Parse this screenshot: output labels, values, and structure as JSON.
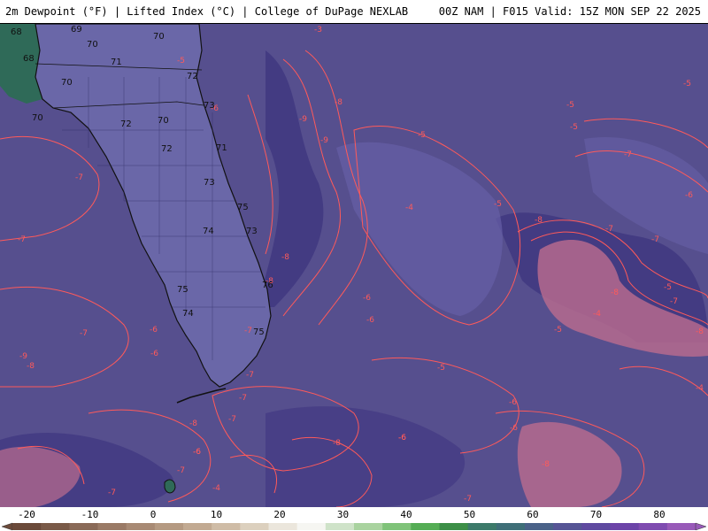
{
  "header": {
    "left_title": "2m Dewpoint (°F) | Lifted Index (°C) | College of DuPage NEXLAB",
    "right_title": "00Z NAM | F015 Valid: 15Z MON SEP 22 2025"
  },
  "map": {
    "background_color": "#564f8e",
    "contour_color": "#ff5a5a",
    "dewpoint_labels": [
      "69",
      "70",
      "70",
      "71",
      "70",
      "68",
      "68",
      "70",
      "72",
      "73",
      "72",
      "70",
      "72",
      "71",
      "73",
      "75",
      "73",
      "74",
      "75",
      "74",
      "76",
      "75"
    ],
    "lifted_index_labels": [
      "-3",
      "-6",
      "-5",
      "-7",
      "-7",
      "-7",
      "-9",
      "-9",
      "-8",
      "-8",
      "-8",
      "-8",
      "-8",
      "-5",
      "-5",
      "-5",
      "-5",
      "-6",
      "-6",
      "-6",
      "-7",
      "-7",
      "-7",
      "-8",
      "-8",
      "-7",
      "-7",
      "-9",
      "-8",
      "-7",
      "-6",
      "-4",
      "-4",
      "-4",
      "-6",
      "-6",
      "-6",
      "-5",
      "-5",
      "-4",
      "-7",
      "-8",
      "-5",
      "-6",
      "-6",
      "-7",
      "-7",
      "-7",
      "-6",
      "-6",
      "-7",
      "-5",
      "-8"
    ]
  },
  "colorbar": {
    "ticks": [
      "-20",
      "-10",
      "0",
      "10",
      "20",
      "30",
      "40",
      "50",
      "60",
      "70",
      "80"
    ],
    "colors": [
      "#6b4a3a",
      "#7a5a48",
      "#8a6a58",
      "#9a7a66",
      "#a88a74",
      "#b59a82",
      "#c2aa92",
      "#cfbca6",
      "#dcd0be",
      "#ebe6dc",
      "#f6f6f2",
      "#cfe3c9",
      "#a9d39f",
      "#7fc379",
      "#55ad55",
      "#3d8f47",
      "#3c7a6a",
      "#3f6f78",
      "#4a6288",
      "#565595",
      "#5f4aa0",
      "#6c44a8",
      "#7f4cb0",
      "#985ab8"
    ]
  }
}
